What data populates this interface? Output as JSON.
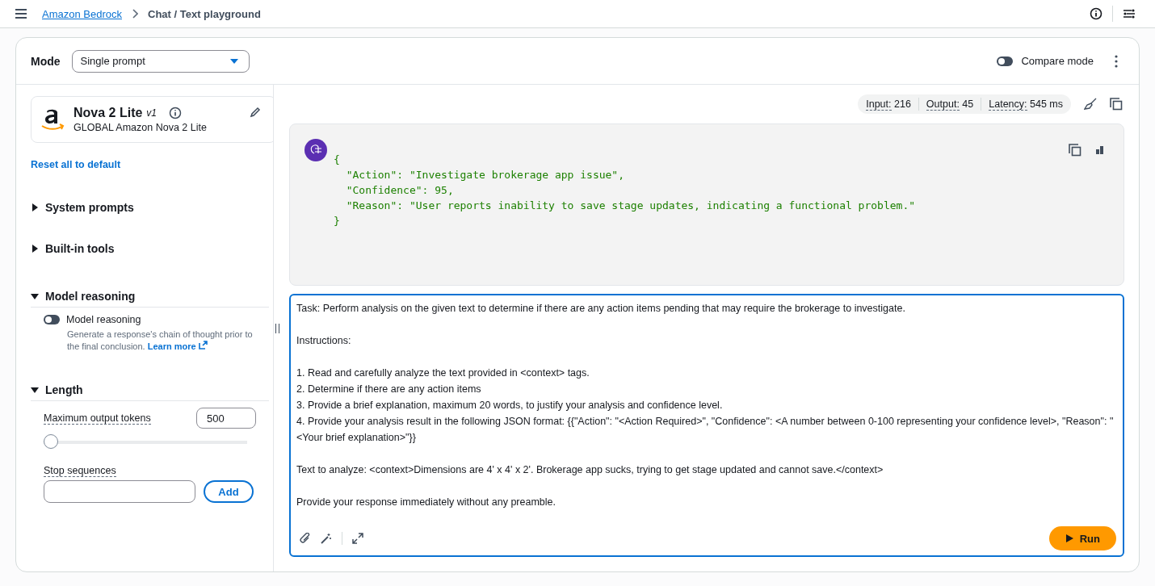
{
  "header": {
    "breadcrumb_link": "Amazon Bedrock",
    "current_page": "Chat / Text playground"
  },
  "mode": {
    "label": "Mode",
    "value": "Single prompt"
  },
  "compare_mode": {
    "label": "Compare mode",
    "on": false
  },
  "model": {
    "name": "Nova 2 Lite",
    "version": "v1",
    "provider": "GLOBAL Amazon Nova 2 Lite"
  },
  "reset_link": "Reset all to default",
  "sections": [
    {
      "title": "System prompts",
      "expanded": false
    },
    {
      "title": "Built-in tools",
      "expanded": false
    },
    {
      "kind": "reasoning",
      "title": "Model reasoning",
      "expanded": true
    },
    {
      "kind": "length",
      "title": "Length",
      "expanded": true
    }
  ],
  "reasoning": {
    "label": "Model reasoning",
    "on": false,
    "description": "Generate a response's chain of thought prior to the final conclusion.",
    "learn_more": "Learn more"
  },
  "length": {
    "max_tokens_label": "Maximum output tokens",
    "max_tokens_value": "500",
    "level": 0,
    "stop_sequences_label": "Stop sequences",
    "add_button": "Add"
  },
  "stats": [
    {
      "label": "Input:",
      "value": "216"
    },
    {
      "label": "Output:",
      "value": "45"
    },
    {
      "label": "Latency:",
      "value": "545 ms"
    }
  ],
  "response_lines": [
    "{",
    "  \"Action\": \"Investigate brokerage app issue\",",
    "  \"Confidence\": 95,",
    "  \"Reason\": \"User reports inability to save stage updates, indicating a functional problem.\"",
    "}"
  ],
  "prompt_blocks": [
    [
      "Task: Perform analysis on the given text to determine if there are any action items pending that may require the brokerage to investigate."
    ],
    [
      "Instructions:"
    ],
    [
      "1. Read and carefully analyze the text provided in <context> tags.",
      "2. Determine if there are any action items",
      "3. Provide a brief explanation, maximum 20 words, to justify your analysis and confidence level.",
      "4. Provide your analysis result in the following JSON format: {{\"Action\": \"<Action Required>\", \"Confidence\": <A number between 0-100 representing your confidence level>, \"Reason\": \"<Your brief explanation>\"}}"
    ],
    [
      "Text to analyze: <context>Dimensions are 4' x 4' x 2'. Brokerage app sucks, trying to get stage updated and cannot save.</context>"
    ],
    [
      "Provide your response immediately without any preamble."
    ]
  ],
  "run_button": "Run"
}
